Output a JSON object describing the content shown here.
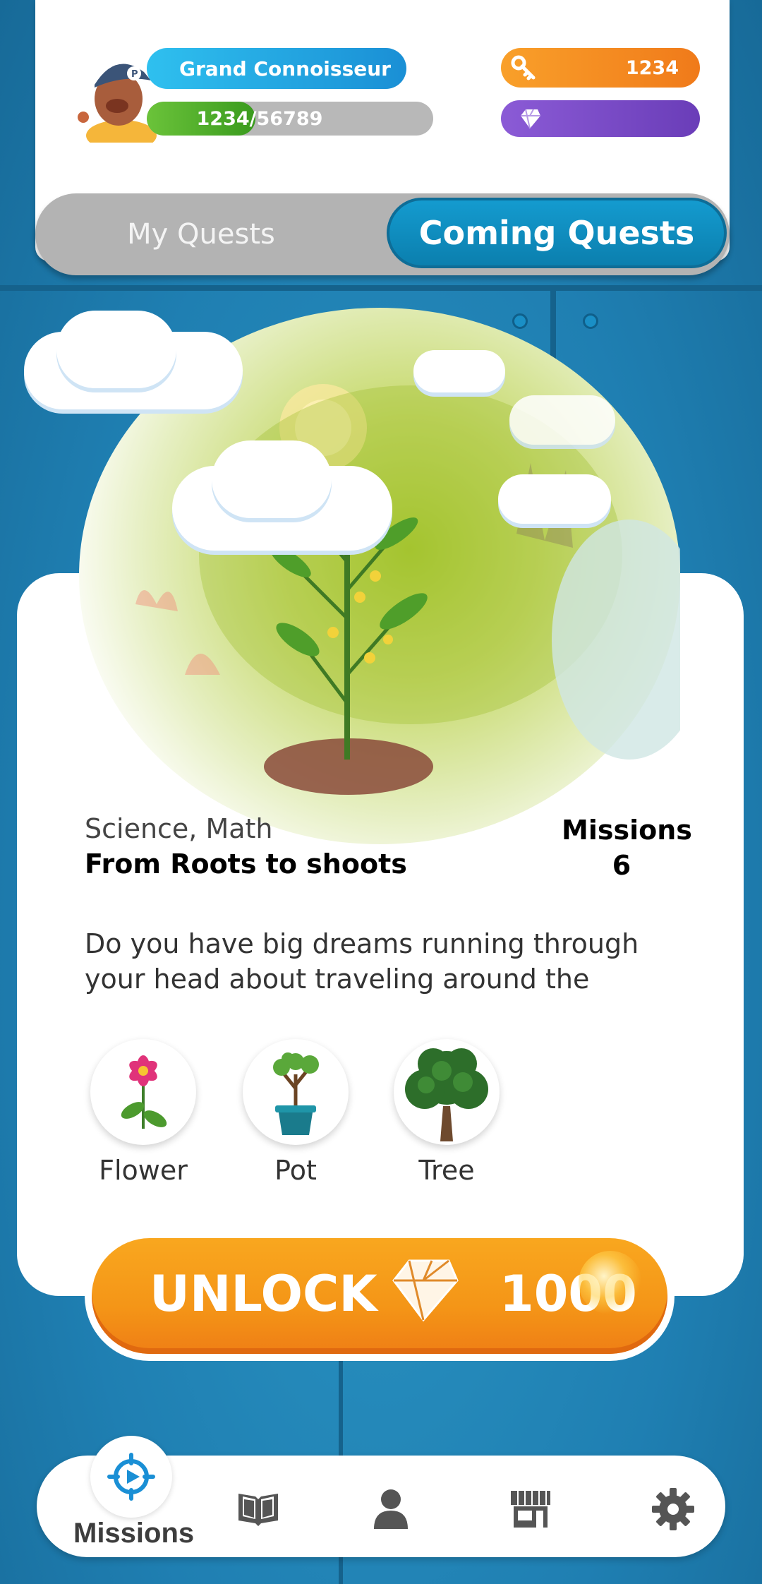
{
  "header": {
    "rank": "Grand Connoisseur",
    "xp": "1234/56789",
    "xp_progress": 0.38,
    "keys": "1234",
    "gems": ""
  },
  "tabs": {
    "my_quests": "My Quests",
    "coming_quests": "Coming Quests",
    "active": "coming_quests"
  },
  "quest": {
    "subjects": "Science, Math",
    "title": "From Roots to shoots",
    "missions_label": "Missions",
    "missions_count": "6",
    "description_line1": "Do you have big dreams running through",
    "description_line2": "your head about traveling around the",
    "rewards": [
      {
        "label": "Flower",
        "icon": "flower-icon"
      },
      {
        "label": "Pot",
        "icon": "potted-tree-icon"
      },
      {
        "label": "Tree",
        "icon": "tree-icon"
      }
    ],
    "unlock_label": "UNLOCK",
    "unlock_cost": "1000"
  },
  "nav": {
    "items": [
      {
        "label": "Missions",
        "icon": "missions-icon",
        "active": true
      },
      {
        "label": "",
        "icon": "book-icon"
      },
      {
        "label": "",
        "icon": "profile-icon"
      },
      {
        "label": "",
        "icon": "store-icon"
      },
      {
        "label": "",
        "icon": "gear-icon"
      }
    ]
  },
  "colors": {
    "background": "#1e7fb0",
    "tab_active": "#0b7fae",
    "unlock_orange": "#f49517",
    "rank_blue": "#1a8fd5",
    "key_orange": "#f07a1a",
    "gem_purple": "#6a3db8",
    "xp_green": "#3a9b1e"
  }
}
